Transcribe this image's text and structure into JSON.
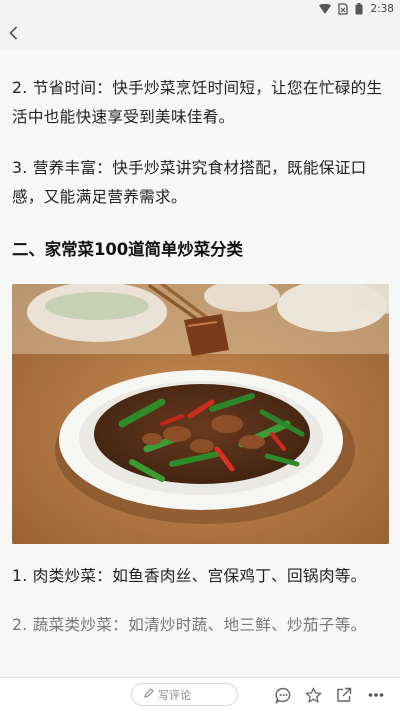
{
  "status_bar": {
    "time": "2:38",
    "icons": [
      "wifi-icon",
      "no-sim-icon",
      "battery-icon"
    ]
  },
  "nav": {
    "back_icon": "back-arrow-icon"
  },
  "article": {
    "paragraphs": [
      "2. 节省时间：快手炒菜烹饪时间短，让您在忙碌的生活中也能快速享受到美味佳肴。",
      "3. 营养丰富：快手炒菜讲究食材搭配，既能保证口感，又能满足营养需求。"
    ],
    "section_heading": "二、家常菜100道简单炒菜分类",
    "photo_subject": "stir-fried pork with green peppers on a white plate",
    "after_photo": [
      "1. 肉类炒菜：如鱼香肉丝、宫保鸡丁、回锅肉等。",
      "2. 蔬菜类炒菜：如清炒时蔬、地三鲜、炒茄子等。"
    ]
  },
  "bottom_bar": {
    "comment_placeholder": "写评论",
    "icons": [
      "pencil-icon",
      "comment-icon",
      "star-icon",
      "share-icon",
      "more-icon"
    ]
  },
  "colors": {
    "background": "#f7f7f7",
    "bar": "#f3f3f3",
    "text": "#222222"
  }
}
